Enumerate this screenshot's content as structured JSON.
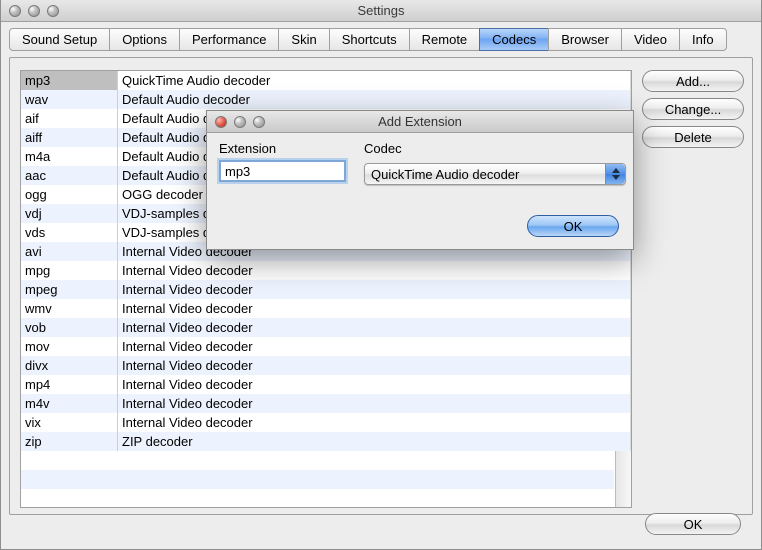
{
  "window": {
    "title": "Settings"
  },
  "tabs": [
    {
      "label": "Sound Setup"
    },
    {
      "label": "Options"
    },
    {
      "label": "Performance"
    },
    {
      "label": "Skin"
    },
    {
      "label": "Shortcuts"
    },
    {
      "label": "Remote"
    },
    {
      "label": "Codecs",
      "active": true
    },
    {
      "label": "Browser"
    },
    {
      "label": "Video"
    },
    {
      "label": "Info"
    }
  ],
  "codec_rows": [
    {
      "ext": "mp3",
      "codec": "QuickTime Audio decoder",
      "selected": true
    },
    {
      "ext": "wav",
      "codec": "Default Audio decoder"
    },
    {
      "ext": "aif",
      "codec": "Default Audio decoder"
    },
    {
      "ext": "aiff",
      "codec": "Default Audio decoder"
    },
    {
      "ext": "m4a",
      "codec": "Default Audio decoder"
    },
    {
      "ext": "aac",
      "codec": "Default Audio decoder"
    },
    {
      "ext": "ogg",
      "codec": "OGG decoder"
    },
    {
      "ext": "vdj",
      "codec": "VDJ-samples decoder"
    },
    {
      "ext": "vds",
      "codec": "VDJ-samples decoder"
    },
    {
      "ext": "avi",
      "codec": "Internal Video decoder"
    },
    {
      "ext": "mpg",
      "codec": "Internal Video decoder"
    },
    {
      "ext": "mpeg",
      "codec": "Internal Video decoder"
    },
    {
      "ext": "wmv",
      "codec": "Internal Video decoder"
    },
    {
      "ext": "vob",
      "codec": "Internal Video decoder"
    },
    {
      "ext": "mov",
      "codec": "Internal Video decoder"
    },
    {
      "ext": "divx",
      "codec": "Internal Video decoder"
    },
    {
      "ext": "mp4",
      "codec": "Internal Video decoder"
    },
    {
      "ext": "m4v",
      "codec": "Internal Video decoder"
    },
    {
      "ext": "vix",
      "codec": "Internal Video decoder"
    },
    {
      "ext": "zip",
      "codec": "ZIP decoder"
    }
  ],
  "buttons": {
    "add": "Add...",
    "change": "Change...",
    "delete": "Delete",
    "ok": "OK"
  },
  "dialog": {
    "title": "Add Extension",
    "label_extension": "Extension",
    "label_codec": "Codec",
    "extension_value": "mp3",
    "codec_value": "QuickTime Audio decoder",
    "ok": "OK"
  }
}
